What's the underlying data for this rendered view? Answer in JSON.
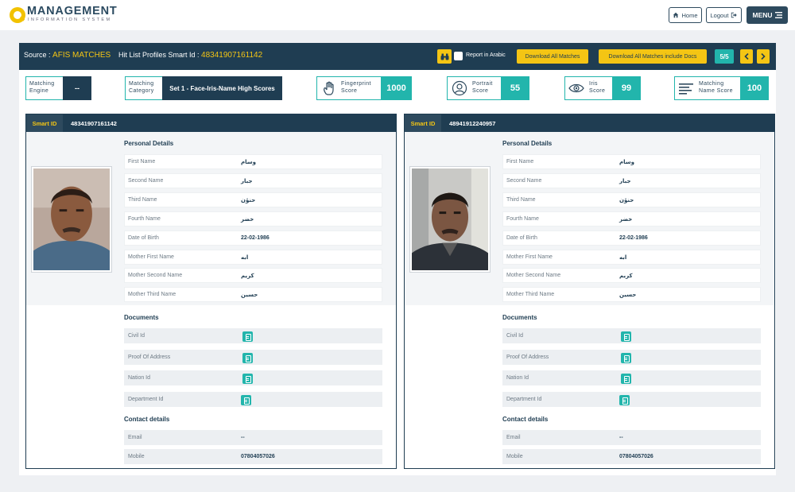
{
  "header": {
    "logo_main": "MANAGEMENT",
    "logo_sub": "INFORMATION SYSTEM",
    "home_label": "Home",
    "logout_label": "Logout",
    "menu_label": "MENU"
  },
  "source_bar": {
    "source_label": "Source :",
    "source_value": "AFIS MATCHES",
    "hitlist_label": "Hit List Profiles Smart Id :",
    "hitlist_value": "48341907161142",
    "report_arabic_label": "Report in Arabic",
    "download_all_label": "Download All Matches",
    "download_docs_label": "Download All Matches include Docs",
    "page_indicator": "5/5"
  },
  "scores": {
    "matching_engine": {
      "label1": "Matching",
      "label2": "Engine",
      "value": "--"
    },
    "matching_category": {
      "label1": "Matching",
      "label2": "Category",
      "value": "Set 1 - Face-Iris-Name High Scores"
    },
    "fingerprint": {
      "label1": "Fingerprint",
      "label2": "Score",
      "value": "1000"
    },
    "portrait": {
      "label1": "Portrait",
      "label2": "Score",
      "value": "55"
    },
    "iris": {
      "label1": "Iris",
      "label2": "Score",
      "value": "99"
    },
    "name_score": {
      "label1": "Matching",
      "label2": "Name Score",
      "value": "100"
    }
  },
  "labels": {
    "smart_id": "Smart ID",
    "personal_details": "Personal Details",
    "documents": "Documents",
    "contact_details": "Contact details",
    "first_name": "First Name",
    "second_name": "Second Name",
    "third_name": "Third Name",
    "fourth_name": "Fourth Name",
    "dob": "Date of Birth",
    "mother_first": "Mother First Name",
    "mother_second": "Mother Second Name",
    "mother_third": "Mother Third Name",
    "civil_id": "Civil Id",
    "proof_address": "Proof Of Address",
    "nation_id": "Nation Id",
    "department_id": "Department Id",
    "email": "Email",
    "mobile": "Mobile"
  },
  "profiles": [
    {
      "smart_id": "48341907161142",
      "first_name": "وسام",
      "second_name": "جبار",
      "third_name": "حنؤن",
      "fourth_name": "خضر",
      "dob": "22-02-1986",
      "mother_first": "ابه",
      "mother_second": "كريم",
      "mother_third": "حسين",
      "email": "--",
      "mobile": "07804057026"
    },
    {
      "smart_id": "48941912240957",
      "first_name": "وسام",
      "second_name": "جبار",
      "third_name": "حنؤن",
      "fourth_name": "خضر",
      "dob": "22-02-1986",
      "mother_first": "ابه",
      "mother_second": "كريم",
      "mother_third": "حسين",
      "email": "--",
      "mobile": "07804057026"
    }
  ],
  "colors": {
    "navy": "#1f3d52",
    "teal": "#22b5ac",
    "yellow": "#f4c514"
  }
}
